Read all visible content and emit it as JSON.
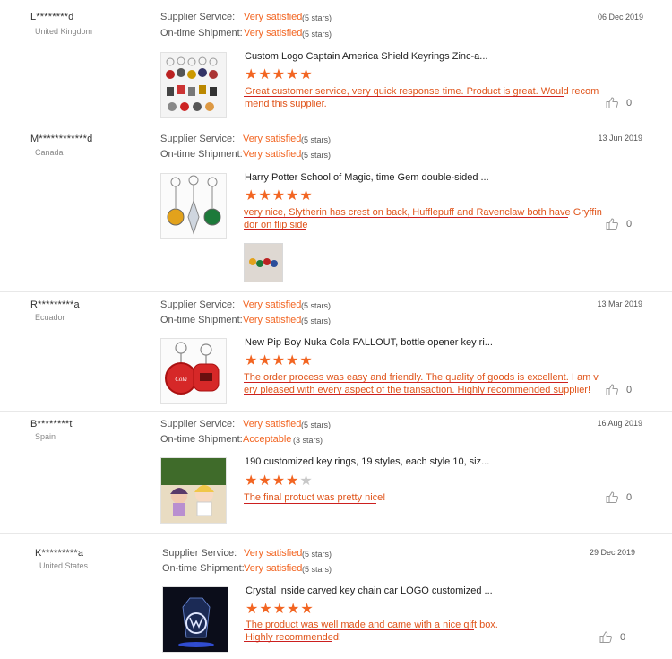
{
  "labels": {
    "supplier_service": "Supplier Service:",
    "ontime_shipment": "On-time Shipment:"
  },
  "colors": {
    "accent": "#f26522",
    "underline": "#cc1f1f",
    "star_off": "#c8c8c8"
  },
  "reviews": [
    {
      "buyer": "L********d",
      "country": "United Kingdom",
      "date": "06 Dec 2019",
      "supplier_service": "Very satisfied",
      "supplier_stars": "(5 stars)",
      "shipment": "Very satisfied",
      "shipment_stars": "(5 stars)",
      "product_title": "Custom Logo Captain America Shield Keyrings Zinc-a...",
      "rating": 5,
      "comment_lines": [
        "Great customer service, very quick response time. Product is great. Would recom",
        "mend this supplier."
      ],
      "likes": "0",
      "product_icon": "keyring-assortment-image"
    },
    {
      "buyer": "M************d",
      "country": "Canada",
      "date": "13 Jun 2019",
      "supplier_service": "Very satisfied",
      "supplier_stars": "(5 stars)",
      "shipment": "Very satisfied",
      "shipment_stars": "(5 stars)",
      "product_title": "Harry Potter School of Magic, time Gem double-sided ...",
      "rating": 5,
      "comment_lines": [
        "very nice, Slytherin has crest on back, Hufflepuff and Ravenclaw both have Gryffin",
        "dor on flip side"
      ],
      "likes": "0",
      "product_icon": "house-keyrings-image"
    },
    {
      "buyer": "R*********a",
      "country": "Ecuador",
      "date": "13 Mar 2019",
      "supplier_service": "Very satisfied",
      "supplier_stars": "(5 stars)",
      "shipment": "Very satisfied",
      "shipment_stars": "(5 stars)",
      "product_title": "New Pip Boy Nuka Cola FALLOUT, bottle opener key ri...",
      "rating": 5,
      "comment_lines": [
        "The order process was easy and friendly. The quality of goods is excellent. I am v",
        "ery pleased with every aspect of the transaction. Highly recommended supplier!"
      ],
      "likes": "0",
      "product_icon": "bottle-opener-keyring-image"
    },
    {
      "buyer": "B********t",
      "country": "Spain",
      "date": "16 Aug 2019",
      "supplier_service": "Very satisfied",
      "supplier_stars": "(5 stars)",
      "shipment": "Acceptable",
      "shipment_stars": "(3 stars)",
      "product_title": "190 customized key rings, 19 styles, each style 10, siz...",
      "rating": 4,
      "comment_lines": [
        "The final protuct was pretty nice!"
      ],
      "likes": "0",
      "product_icon": "acrylic-figure-keyrings-image"
    },
    {
      "buyer": "K*********a",
      "country": "United States",
      "date": "29 Dec 2019",
      "supplier_service": "Very satisfied",
      "supplier_stars": "(5 stars)",
      "shipment": "Very satisfied",
      "shipment_stars": "(5 stars)",
      "product_title": "Crystal inside carved key chain car LOGO customized ...",
      "rating": 5,
      "comment_lines": [
        "The product was well made and came with a nice gift box.",
        "Highly recommended!"
      ],
      "likes": "0",
      "product_icon": "crystal-car-logo-keychain-image"
    }
  ]
}
